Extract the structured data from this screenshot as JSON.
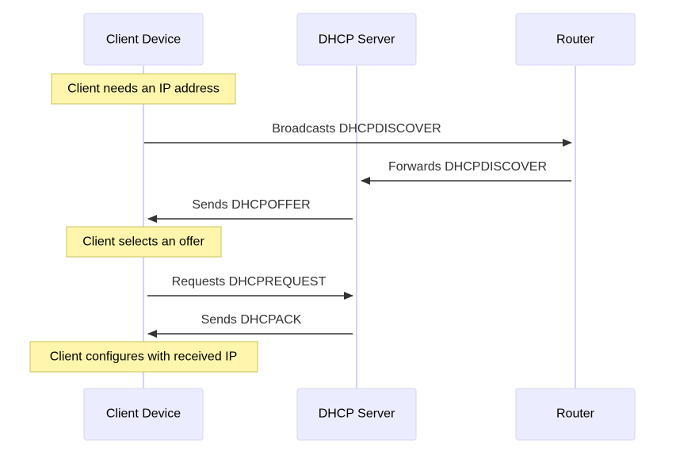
{
  "participants": [
    {
      "id": "client",
      "label": "Client Device"
    },
    {
      "id": "dhcp",
      "label": "DHCP Server"
    },
    {
      "id": "router",
      "label": "Router"
    }
  ],
  "messages": [
    {
      "from": "Client Device",
      "to": "Router",
      "label": "Broadcasts DHCPDISCOVER"
    },
    {
      "from": "Router",
      "to": "DHCP Server",
      "label": "Forwards DHCPDISCOVER"
    },
    {
      "from": "DHCP Server",
      "to": "Client Device",
      "label": "Sends DHCPOFFER"
    },
    {
      "from": "Client Device",
      "to": "DHCP Server",
      "label": "Requests DHCPREQUEST"
    },
    {
      "from": "DHCP Server",
      "to": "Client Device",
      "label": "Sends DHCPACK"
    }
  ],
  "notes": [
    {
      "over": "Client Device",
      "label": "Client needs an IP address"
    },
    {
      "over": "Client Device",
      "label": "Client selects an offer"
    },
    {
      "over": "Client Device",
      "label": "Client configures with received IP"
    }
  ],
  "colors": {
    "actor_fill": "#ECECFF",
    "actor_border": "#D4D4F6",
    "note_fill": "#FFF5AD",
    "note_border": "#C9C35A",
    "line": "#333333"
  }
}
